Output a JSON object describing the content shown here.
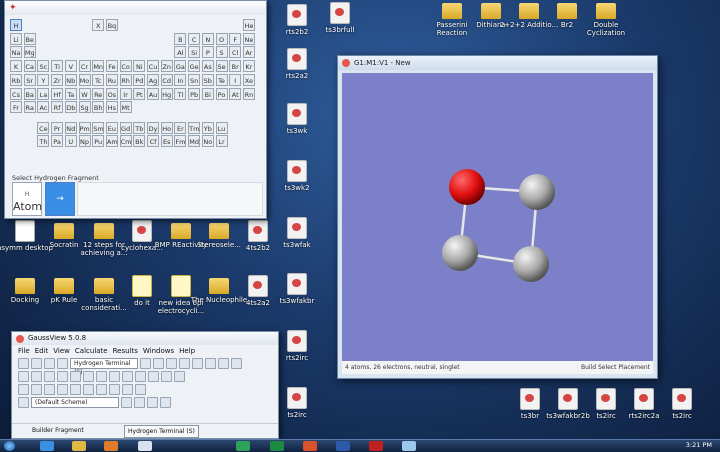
{
  "desktop_icons": [
    {
      "label": "rts2b2",
      "kind": "file"
    },
    {
      "label": "ts3brfull",
      "kind": "file"
    },
    {
      "label": "Passerini Reaction",
      "kind": "folder"
    },
    {
      "label": "Dithiana",
      "kind": "folder"
    },
    {
      "label": "2+2+2 Additio...",
      "kind": "folder"
    },
    {
      "label": "Br2",
      "kind": "folder"
    },
    {
      "label": "Double Cyclization",
      "kind": "folder"
    },
    {
      "label": "rts2a2",
      "kind": "file"
    },
    {
      "label": "ts3wk",
      "kind": "file"
    },
    {
      "label": "ts3wk2",
      "kind": "file"
    },
    {
      "label": "ts3wfak",
      "kind": "file"
    },
    {
      "label": "ts3wfakbr",
      "kind": "file"
    },
    {
      "label": "rts2irc",
      "kind": "file"
    },
    {
      "label": "ts2irc",
      "kind": "file"
    },
    {
      "label": "asymm desktop",
      "kind": "doc"
    },
    {
      "label": "Socratin",
      "kind": "folder"
    },
    {
      "label": "12 steps for achieving a...",
      "kind": "folder"
    },
    {
      "label": "cyclohexa...",
      "kind": "file"
    },
    {
      "label": "BMP REactivity",
      "kind": "folder"
    },
    {
      "label": "Stereosele...",
      "kind": "folder"
    },
    {
      "label": "4ts2b2",
      "kind": "file"
    },
    {
      "label": "Docking",
      "kind": "folder"
    },
    {
      "label": "pK Rule",
      "kind": "folder"
    },
    {
      "label": "basic considerati...",
      "kind": "folder"
    },
    {
      "label": "do it",
      "kind": "note"
    },
    {
      "label": "new idea 6pi electrocycli...",
      "kind": "note"
    },
    {
      "label": "The Nucleophile",
      "kind": "folder"
    },
    {
      "label": "4ts2a2",
      "kind": "file"
    },
    {
      "label": "ts3br",
      "kind": "file"
    },
    {
      "label": "ts3wfakbr2b",
      "kind": "file"
    },
    {
      "label": "ts2irc",
      "kind": "file"
    },
    {
      "label": "rts2irc2a",
      "kind": "file"
    },
    {
      "label": "ts2irc",
      "kind": "file"
    }
  ],
  "periodic_table": {
    "rows": [
      [
        "H",
        "",
        "",
        "",
        "",
        "",
        "",
        "",
        "",
        "",
        "",
        "",
        "",
        "",
        "",
        "",
        "",
        "He"
      ],
      [
        "Li",
        "Be",
        "",
        "",
        "",
        "",
        "",
        "",
        "",
        "",
        "",
        "",
        "B",
        "C",
        "N",
        "O",
        "F",
        "Ne"
      ],
      [
        "Na",
        "Mg",
        "",
        "",
        "",
        "",
        "",
        "",
        "",
        "",
        "",
        "",
        "Al",
        "Si",
        "P",
        "S",
        "Cl",
        "Ar"
      ],
      [
        "K",
        "Ca",
        "Sc",
        "Ti",
        "V",
        "Cr",
        "Mn",
        "Fe",
        "Co",
        "Ni",
        "Cu",
        "Zn",
        "Ga",
        "Ge",
        "As",
        "Se",
        "Br",
        "Kr"
      ],
      [
        "Rb",
        "Sr",
        "Y",
        "Zr",
        "Nb",
        "Mo",
        "Tc",
        "Ru",
        "Rh",
        "Pd",
        "Ag",
        "Cd",
        "In",
        "Sn",
        "Sb",
        "Te",
        "I",
        "Xe"
      ],
      [
        "Cs",
        "Ba",
        "La",
        "Hf",
        "Ta",
        "W",
        "Re",
        "Os",
        "Ir",
        "Pt",
        "Au",
        "Hg",
        "Tl",
        "Pb",
        "Bi",
        "Po",
        "At",
        "Rn"
      ],
      [
        "Fr",
        "Ra",
        "Ac",
        "Rf",
        "Db",
        "Sg",
        "Bh",
        "Hs",
        "Mt",
        "",
        "",
        "",
        "",
        "",
        "",
        "",
        "",
        ""
      ]
    ],
    "x_bq": [
      "X",
      "Bq"
    ],
    "lanthanides": [
      "Ce",
      "Pr",
      "Nd",
      "Pm",
      "Sm",
      "Eu",
      "Gd",
      "Tb",
      "Dy",
      "Ho",
      "Er",
      "Tm",
      "Yb",
      "Lu"
    ],
    "actinides": [
      "Th",
      "Pa",
      "U",
      "Np",
      "Pu",
      "Am",
      "Cm",
      "Bk",
      "Cf",
      "Es",
      "Fm",
      "Md",
      "No",
      "Lr"
    ],
    "selected_element": "H",
    "fragment_label": "Select Hydrogen Fragment",
    "fragment_small": "H",
    "fragment_atom": "Atom"
  },
  "mol_window": {
    "title": "G1:M1:V1 - New",
    "status_left": "4 atoms, 26 electrons, neutral, singlet",
    "status_right": "Build   Select Placement"
  },
  "gaussview": {
    "title": "GaussView 5.0.8",
    "menu": [
      "File",
      "Edit",
      "View",
      "Calculate",
      "Results",
      "Windows",
      "Help"
    ],
    "fragment_combo": "Hydrogen Terminal (S)",
    "scheme_combo": "(Default Scheme)",
    "bottom_left": "Builder Fragment",
    "bottom_right": "Hydrogen Terminal (S)"
  },
  "taskbar": {
    "clock": "3:21 PM",
    "apps": [
      "start",
      "ie",
      "explorer",
      "media",
      "gaussview",
      "chrome",
      "excel",
      "powerpoint",
      "word",
      "adobe",
      "paint"
    ]
  },
  "colors": {
    "oxygen": "#e01010",
    "carbon": "#b0b0b0",
    "canvas": "#7b80c8"
  }
}
